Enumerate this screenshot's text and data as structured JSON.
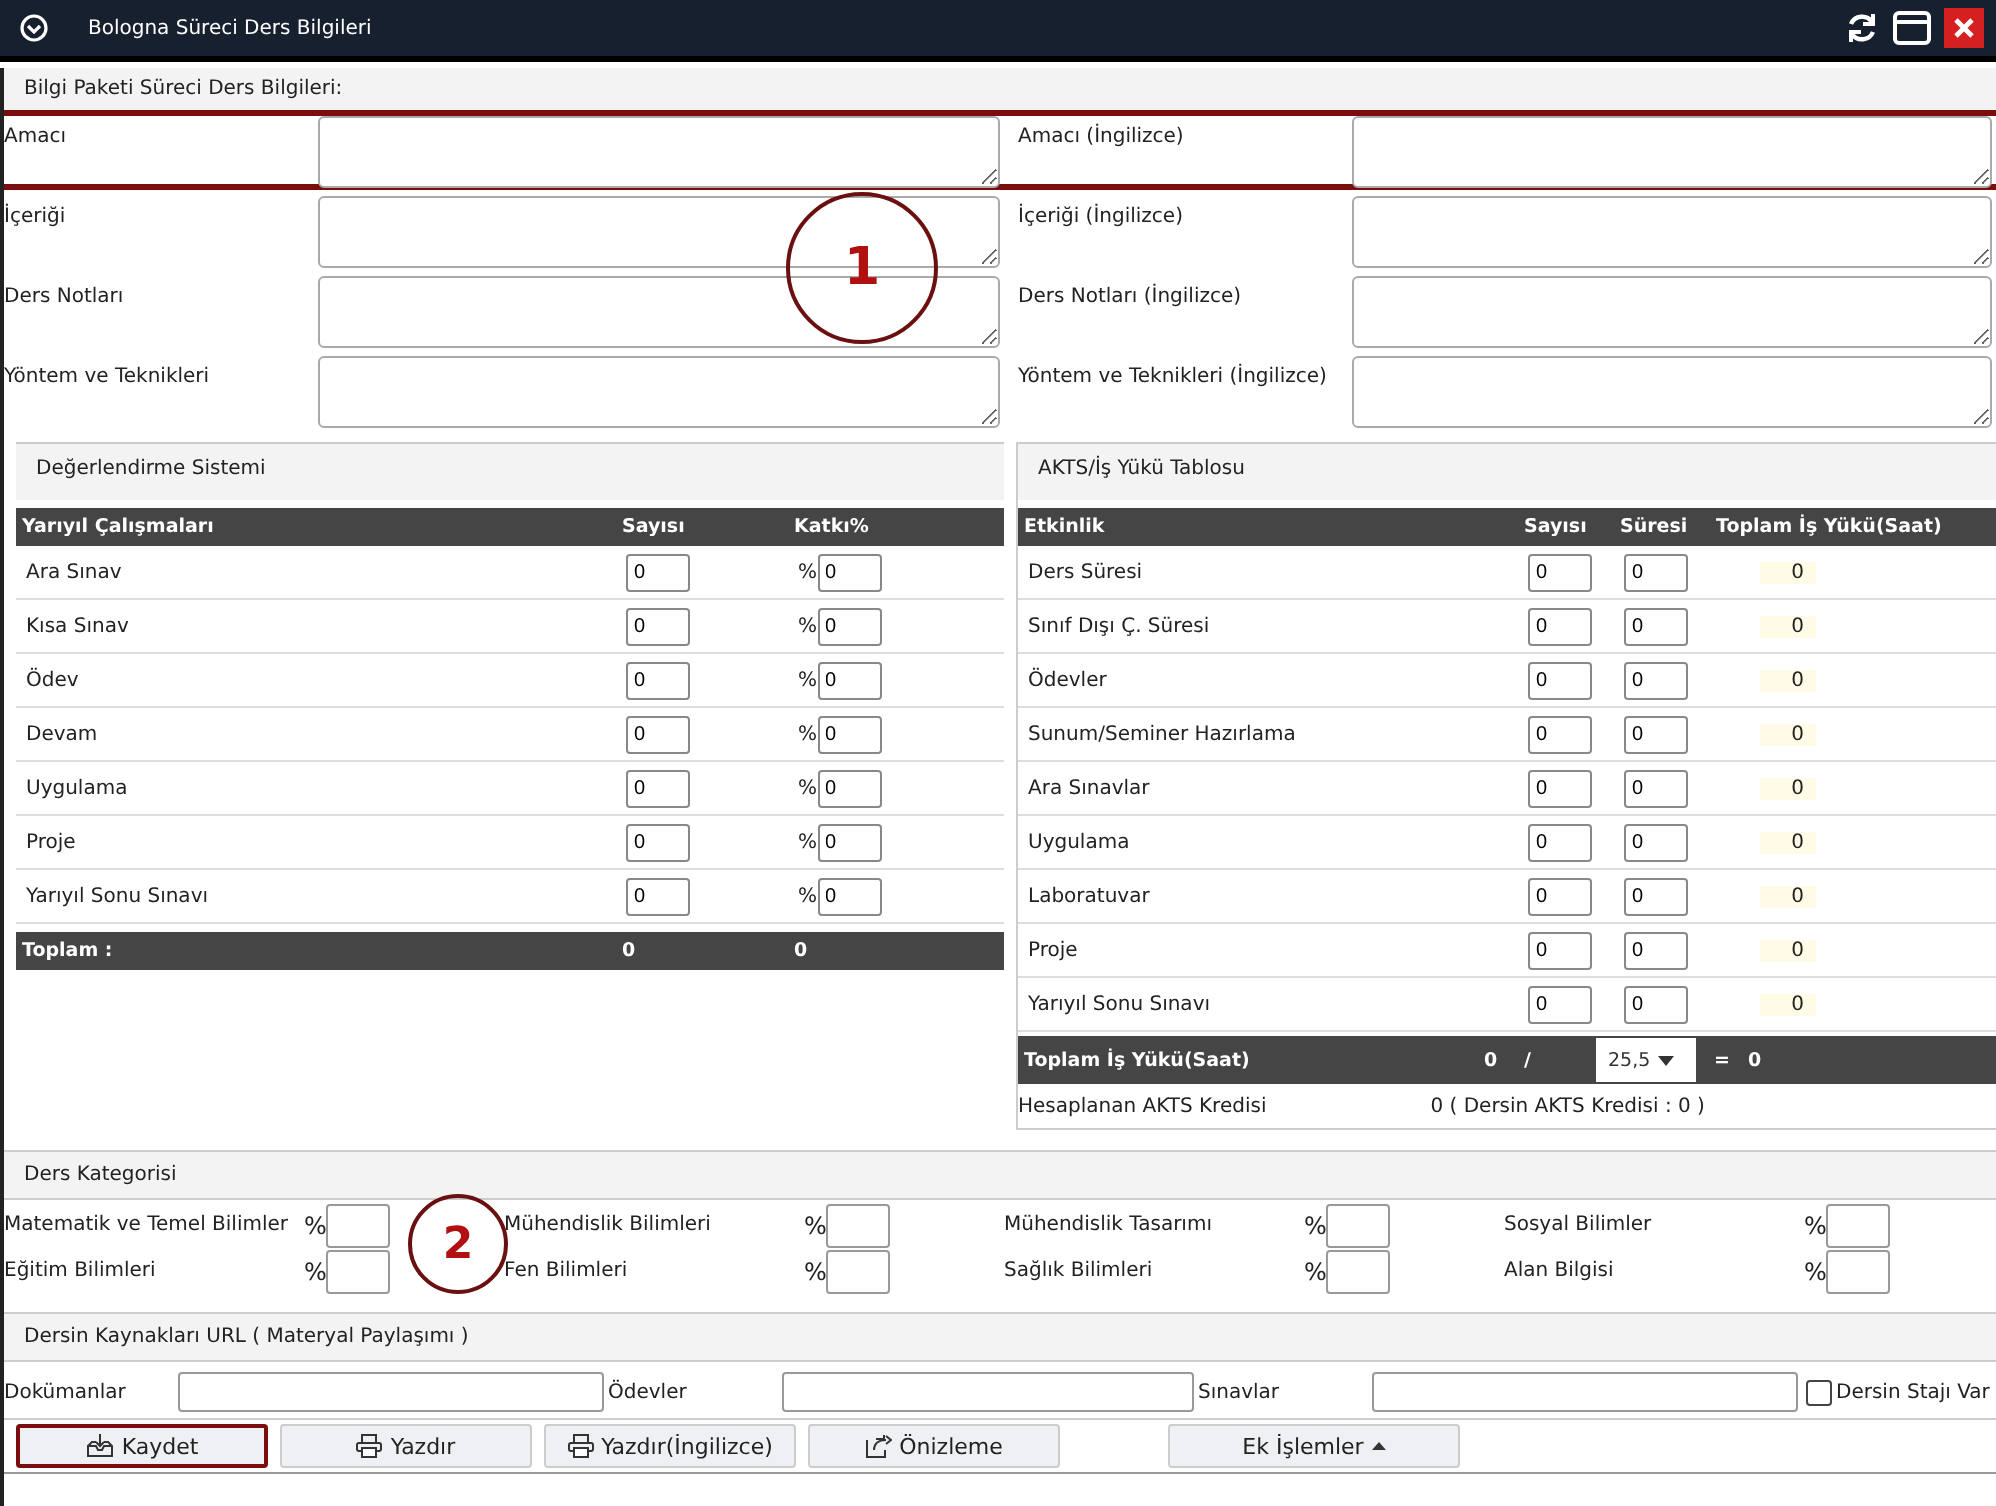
{
  "window": {
    "title": "Bologna Süreci Ders Bilgileri"
  },
  "subtitle": "Bilgi Paketi Süreci Ders Bilgileri:",
  "description_fields": [
    {
      "label": "Amacı",
      "label_en": "Amacı (İngilizce)",
      "highlighted": true
    },
    {
      "label": "İçeriği",
      "label_en": "İçeriği (İngilizce)",
      "highlighted": false
    },
    {
      "label": "Ders Notları",
      "label_en": "Ders Notları (İngilizce)",
      "highlighted": false
    },
    {
      "label": "Yöntem ve Teknikleri",
      "label_en": "Yöntem ve Teknikleri (İngilizce)",
      "highlighted": false
    }
  ],
  "evaluation": {
    "title": "Değerlendirme Sistemi",
    "columns": [
      "Yarıyıl Çalışmaları",
      "Sayısı",
      "Katkı%"
    ],
    "rows": [
      {
        "label": "Ara Sınav",
        "count": "0",
        "prefix": "%",
        "percent": "0"
      },
      {
        "label": "Kısa Sınav",
        "count": "0",
        "prefix": "%",
        "percent": "0"
      },
      {
        "label": "Ödev",
        "count": "0",
        "prefix": "%",
        "percent": "0"
      },
      {
        "label": "Devam",
        "count": "0",
        "prefix": "%",
        "percent": "0"
      },
      {
        "label": "Uygulama",
        "count": "0",
        "prefix": "%",
        "percent": "0"
      },
      {
        "label": "Proje",
        "count": "0",
        "prefix": "%",
        "percent": "0"
      },
      {
        "label": "Yarıyıl Sonu Sınavı",
        "count": "0",
        "prefix": "%",
        "percent": "0"
      }
    ],
    "total": {
      "label": "Toplam :",
      "count": "0",
      "percent": "0"
    }
  },
  "workload": {
    "title": "AKTS/İş Yükü Tablosu",
    "columns": [
      "Etkinlik",
      "Sayısı",
      "Süresi",
      "Toplam İş Yükü(Saat)"
    ],
    "rows": [
      {
        "label": "Ders Süresi",
        "count": "0",
        "duration": "0",
        "total": "0"
      },
      {
        "label": "Sınıf Dışı Ç. Süresi",
        "count": "0",
        "duration": "0",
        "total": "0"
      },
      {
        "label": "Ödevler",
        "count": "0",
        "duration": "0",
        "total": "0"
      },
      {
        "label": "Sunum/Seminer Hazırlama",
        "count": "0",
        "duration": "0",
        "total": "0"
      },
      {
        "label": "Ara Sınavlar",
        "count": "0",
        "duration": "0",
        "total": "0"
      },
      {
        "label": "Uygulama",
        "count": "0",
        "duration": "0",
        "total": "0"
      },
      {
        "label": "Laboratuvar",
        "count": "0",
        "duration": "0",
        "total": "0"
      },
      {
        "label": "Proje",
        "count": "0",
        "duration": "0",
        "total": "0"
      },
      {
        "label": "Yarıyıl Sonu Sınavı",
        "count": "0",
        "duration": "0",
        "total": "0"
      }
    ],
    "total": {
      "label": "Toplam İş Yükü(Saat)",
      "value": "0",
      "divider": "/",
      "divisor": "25,5",
      "equals": "=",
      "result": "0"
    },
    "credit": {
      "label": "Hesaplanan AKTS Kredisi",
      "value": "0 ( Dersin AKTS Kredisi : 0 )"
    }
  },
  "categories": {
    "title": "Ders Kategorisi",
    "items": [
      {
        "label": "Matematik ve Temel Bilimler",
        "prefix": "%"
      },
      {
        "label": "Mühendislik Bilimleri",
        "prefix": "%"
      },
      {
        "label": "Mühendislik Tasarımı",
        "prefix": "%"
      },
      {
        "label": "Sosyal Bilimler",
        "prefix": "%"
      },
      {
        "label": "Eğitim Bilimleri",
        "prefix": "%"
      },
      {
        "label": "Fen Bilimleri",
        "prefix": "%"
      },
      {
        "label": "Sağlık Bilimleri",
        "prefix": "%"
      },
      {
        "label": "Alan Bilgisi",
        "prefix": "%"
      }
    ]
  },
  "resources": {
    "title": "Dersin Kaynakları URL ( Materyal Paylaşımı )",
    "fields": [
      {
        "label": "Dokümanlar"
      },
      {
        "label": "Ödevler"
      },
      {
        "label": "Sınavlar"
      }
    ],
    "checkbox": {
      "label": "Dersin Stajı Var",
      "checked": false
    }
  },
  "buttons": [
    {
      "label": "Kaydet",
      "highlighted": true
    },
    {
      "label": "Yazdır",
      "highlighted": false
    },
    {
      "label": "Yazdır(İngilizce)",
      "highlighted": false
    },
    {
      "label": "Önizleme",
      "highlighted": false
    },
    {
      "label": "Ek İşlemler",
      "highlighted": false
    }
  ],
  "callouts": [
    {
      "text": "1"
    },
    {
      "text": "2"
    }
  ]
}
